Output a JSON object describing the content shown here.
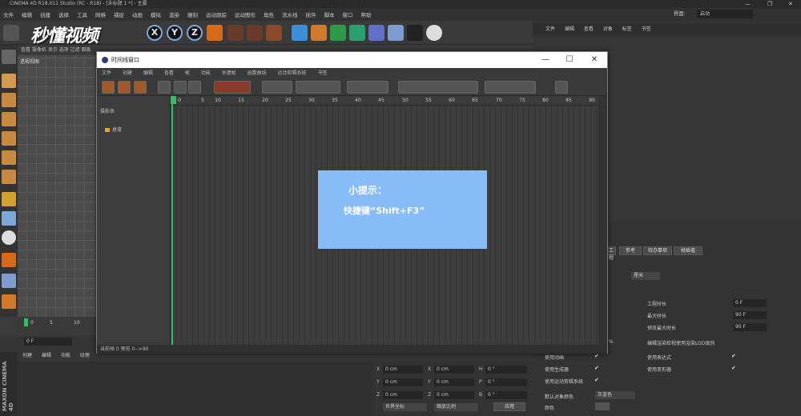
{
  "window": {
    "title": "CINEMA 4D R18.011 Studio (RC - R18) - [未标题 1 *] - 主要"
  },
  "menubar": {
    "items": [
      "文件",
      "编辑",
      "创建",
      "选择",
      "工具",
      "网格",
      "捕捉",
      "动画",
      "模拟",
      "渲染",
      "雕刻",
      "运动跟踪",
      "运动图形",
      "角色",
      "流水线",
      "插件",
      "脚本",
      "窗口",
      "帮助"
    ],
    "layout_label": "界面:",
    "layout_value": "启动"
  },
  "watermark": "秒懂视频",
  "toolbar": {
    "axis_x": "X",
    "axis_y": "Y",
    "axis_z": "Z"
  },
  "viewport": {
    "menu": "查看 摄像机 显示 选项 过滤 面板",
    "label": "透视视图"
  },
  "bottom_timeline": {
    "ticks": [
      "0",
      "5",
      "10"
    ],
    "frame_field": "0 F"
  },
  "bottom_left_menu": {
    "items": [
      "创建",
      "编辑",
      "功能",
      "纹理"
    ]
  },
  "brand": "MAXON CINEMA 4D",
  "right_panel": {
    "menu": [
      "文件",
      "编辑",
      "查看",
      "对象",
      "标签",
      "书签"
    ],
    "tabs": [
      "工程",
      "参考",
      "待办事项",
      "帧插值"
    ],
    "unit_select": "厘米",
    "rows": [
      {
        "label": "工程时长",
        "value": "0 F"
      },
      {
        "label": "最大时长",
        "value": "90 F"
      },
      {
        "label": "预览最大时长",
        "value": "90 F"
      }
    ],
    "lod_label": "编辑渲染检视使用渲染LOD级别",
    "pct": "%",
    "checks": [
      {
        "label": "使用动画",
        "mark": "✔"
      },
      {
        "label": "使用表达式",
        "mark": "✔"
      },
      {
        "label": "使用生成器",
        "mark": "✔"
      },
      {
        "label": "使用变形器",
        "mark": "✔"
      },
      {
        "label": "使用运动剪辑系统",
        "mark": "✔"
      }
    ],
    "default_color_label": "默认对象颜色",
    "default_color_value": "灰蓝色",
    "color_label": "颜色"
  },
  "coords": {
    "labels": [
      "X",
      "Y",
      "Z",
      "X",
      "Y",
      "Z",
      "H",
      "P",
      "B"
    ],
    "values": [
      "0 cm",
      "0 cm",
      "0 cm",
      "0 cm",
      "0 cm",
      "0 cm",
      "0 °",
      "0 °",
      "0 °"
    ],
    "btn_world": "世界坐标",
    "btn_scale": "缩放比例",
    "btn_apply": "应用"
  },
  "dialog": {
    "title": "时间线窗口",
    "menu": [
      "文件",
      "创建",
      "编辑",
      "查看",
      "帧",
      "功能",
      "关键帧",
      "函数曲线",
      "运动剪辑系统",
      "书签"
    ],
    "track_header": "摄影表",
    "track_item": "总览",
    "ruler": [
      "0",
      "5",
      "10",
      "15",
      "20",
      "25",
      "30",
      "35",
      "40",
      "45",
      "50",
      "55",
      "60",
      "65",
      "70",
      "75",
      "80",
      "85",
      "90"
    ],
    "status": "当前帧 0 预览 0-->90"
  },
  "tip": {
    "title": "小提示：",
    "text": "快捷键“Shift+F3”"
  }
}
